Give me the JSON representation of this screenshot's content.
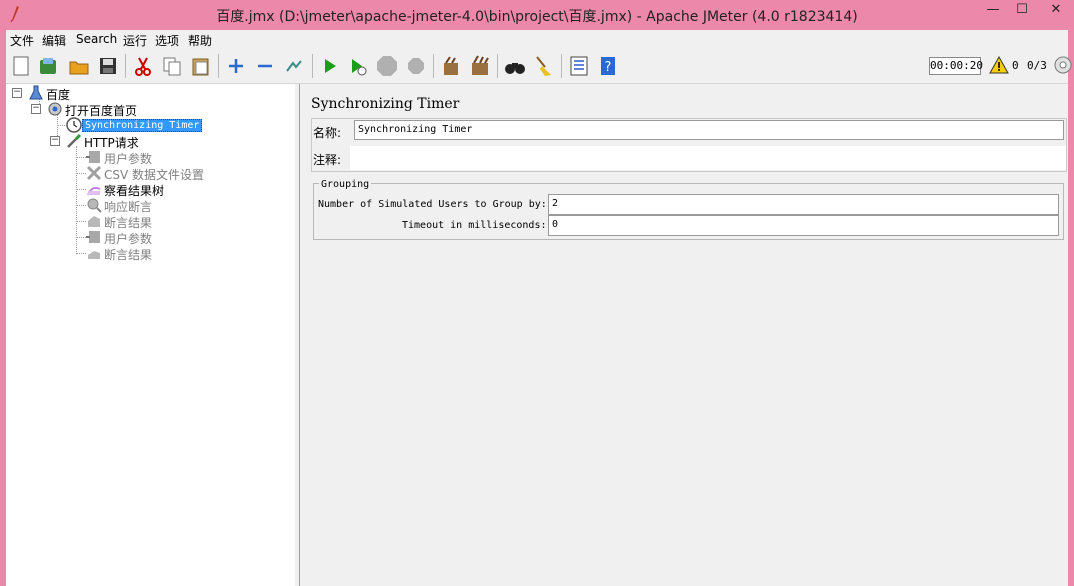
{
  "window": {
    "title": "百度.jmx (D:\\jmeter\\apache-jmeter-4.0\\bin\\project\\百度.jmx) - Apache JMeter (4.0 r1823414)",
    "minimize": "—",
    "maximize": "☐",
    "close": "✕"
  },
  "menu": [
    "文件",
    "编辑",
    "Search",
    "运行",
    "选项",
    "帮助"
  ],
  "toolbar": {
    "timer": "00:00:20",
    "warning_count": "0",
    "thread_count": "0/3"
  },
  "tree": {
    "root": "百度",
    "thread_group": "打开百度首页",
    "timer": "Synchronizing Timer",
    "http": "HTTP请求",
    "children": [
      "用户参数",
      "CSV 数据文件设置",
      "察看结果树",
      "响应断言",
      "断言结果",
      "用户参数",
      "断言结果"
    ]
  },
  "panel": {
    "title": "Synchronizing Timer",
    "name_label": "名称:",
    "name_value": "Synchronizing Timer",
    "comment_label": "注释:",
    "comment_value": "",
    "group_title": "Grouping",
    "users_label": "Number of Simulated Users to Group by:",
    "users_value": "2",
    "timeout_label": "Timeout in milliseconds:",
    "timeout_value": "0"
  },
  "colors": {
    "titlebar": "#ec88a9",
    "selection": "#3399ff",
    "start": "#1a9e1a"
  }
}
